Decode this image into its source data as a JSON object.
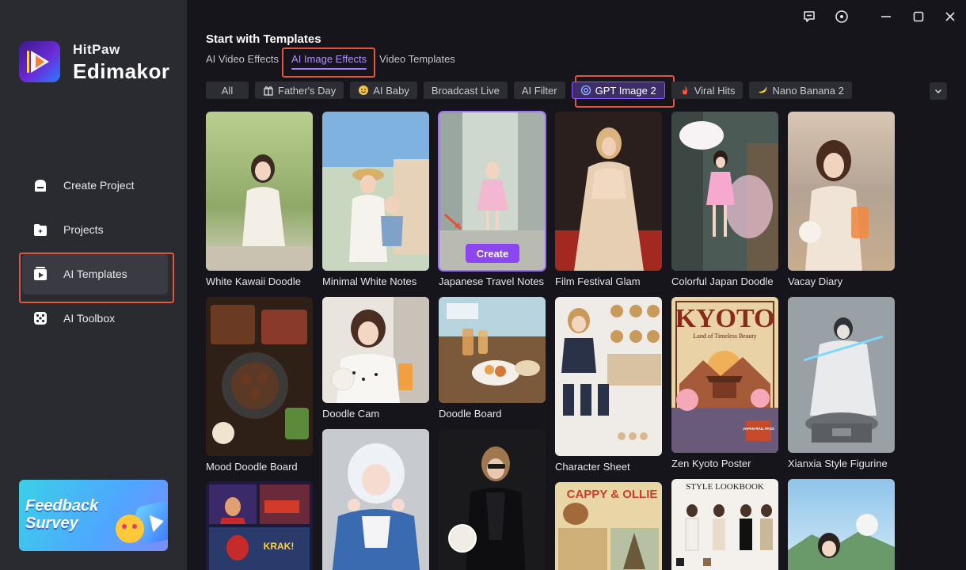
{
  "brand": {
    "line1": "HitPaw",
    "line2": "Edimakor"
  },
  "sidebar": {
    "items": [
      {
        "label": "Create Project",
        "icon": "cloud-upload-icon"
      },
      {
        "label": "Projects",
        "icon": "folder-icon"
      },
      {
        "label": "AI Templates",
        "icon": "template-play-icon"
      },
      {
        "label": "AI Toolbox",
        "icon": "dice-toolbox-icon"
      }
    ],
    "active": "AI Templates"
  },
  "feedback": {
    "line1": "Feedback",
    "line2": "Survey"
  },
  "window": {
    "controls": [
      "chat-icon",
      "menu-icon",
      "minimize-icon",
      "maximize-icon",
      "close-icon"
    ]
  },
  "main": {
    "title": "Start with Templates",
    "tabs": [
      {
        "label": "AI Video Effects"
      },
      {
        "label": "AI Image Effects"
      },
      {
        "label": "Video Templates"
      }
    ],
    "active_tab": "AI Image Effects",
    "chips": [
      {
        "label": "All",
        "icon": ""
      },
      {
        "label": "Father's Day",
        "icon": "gift-icon"
      },
      {
        "label": "AI Baby",
        "icon": "smile-icon"
      },
      {
        "label": "Broadcast Live",
        "icon": ""
      },
      {
        "label": "AI Filter",
        "icon": ""
      },
      {
        "label": "GPT Image 2",
        "icon": "openai-icon"
      },
      {
        "label": "Viral Hits",
        "icon": "fire-icon"
      },
      {
        "label": "Nano Banana 2",
        "icon": "banana-icon"
      }
    ],
    "active_chip": "GPT Image 2",
    "create_label": "Create",
    "templates": [
      {
        "label": "White Kawaii Doodle"
      },
      {
        "label": "Minimal White Notes"
      },
      {
        "label": "Japanese Travel Notes"
      },
      {
        "label": "Film Festival Glam"
      },
      {
        "label": "Colorful Japan Doodle"
      },
      {
        "label": "Vacay Diary"
      },
      {
        "label": "Mood Doodle Board"
      },
      {
        "label": "Doodle Cam"
      },
      {
        "label": "Doodle Board"
      },
      {
        "label": "Character Sheet"
      },
      {
        "label": "Zen Kyoto Poster"
      },
      {
        "label": "Xianxia Style Figurine"
      },
      {
        "label": ""
      },
      {
        "label": ""
      },
      {
        "label": ""
      },
      {
        "label": ""
      },
      {
        "label": ""
      },
      {
        "label": ""
      }
    ],
    "poster_text": {
      "kyoto": "KYOTO",
      "kyoto_sub": "Land of Timeless Beauty",
      "pass": "JAPAN RAIL PASS",
      "lookbook": "STYLE LOOKBOOK",
      "comic": "CAPPY & OLLIE",
      "krak": "KRAK!"
    }
  }
}
